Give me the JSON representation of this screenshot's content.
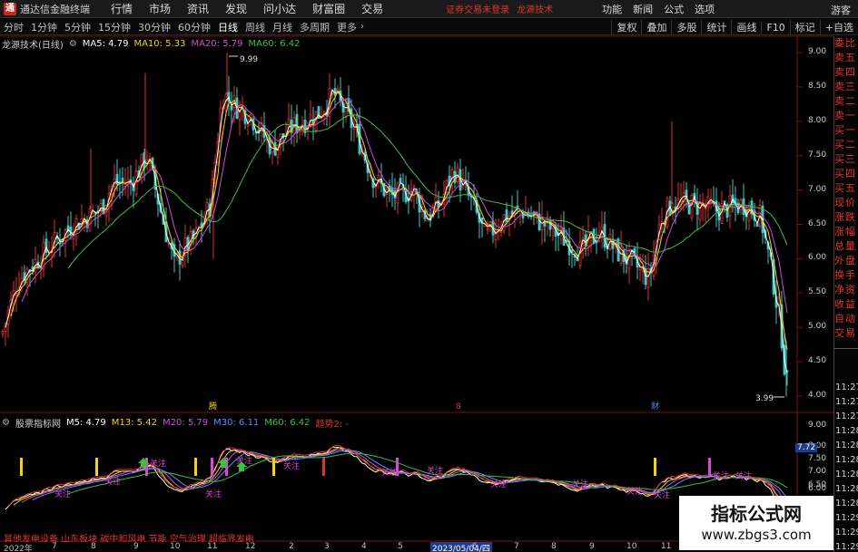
{
  "titlebar": {
    "app_title": "通达信金融终端",
    "menu": [
      "行情",
      "市场",
      "资讯",
      "发现",
      "问小达",
      "财富圈",
      "交易"
    ],
    "login_status": "证券交易未登录",
    "brand_label": "龙源技术",
    "right_items": [
      "功能",
      "新闻",
      "公式",
      "选项"
    ],
    "user_label": "游客"
  },
  "toolbar": {
    "periods": [
      "分时",
      "1分钟",
      "5分钟",
      "15分钟",
      "30分钟",
      "60分钟",
      "日线",
      "周线",
      "月线",
      "多周期",
      "更多"
    ],
    "active_period": "日线",
    "right_buttons": [
      "复权",
      "叠加",
      "多股",
      "统计",
      "画线",
      "F10",
      "标记",
      "+自选"
    ]
  },
  "main_chart": {
    "name": "龙源技术(日线)",
    "ma": [
      {
        "label": "MA5: 4.79",
        "color": "#ffffff"
      },
      {
        "label": "MA10: 5.33",
        "color": "#f2d21b"
      },
      {
        "label": "MA20: 5.79",
        "color": "#d24bd2"
      },
      {
        "label": "MA60: 6.42",
        "color": "#3fbf3f"
      }
    ],
    "high_label": "9.99",
    "low_label": "3.99",
    "markers": [
      "腾",
      "8",
      "财"
    ],
    "y_ticks": [
      "9.00",
      "8.50",
      "8.00",
      "7.50",
      "7.00",
      "6.50",
      "6.00",
      "5.50",
      "5.00",
      "4.50",
      "4.00"
    ]
  },
  "sub_chart": {
    "name": "股票指标网",
    "ma": [
      {
        "label": "M5: 4.79",
        "color": "#ffffff"
      },
      {
        "label": "M13: 5.42",
        "color": "#f2d21b"
      },
      {
        "label": "M20: 5.79",
        "color": "#d24bd2"
      },
      {
        "label": "M30: 6.11",
        "color": "#5a8cff"
      },
      {
        "label": "M60: 6.42",
        "color": "#3fbf3f"
      },
      {
        "label": "趋势2: -",
        "color": "#e0352b"
      }
    ],
    "y_ticks": [
      "9.00",
      "8.00",
      "7.50",
      "7.00",
      "6.50",
      "6.00"
    ],
    "current_value": "7.72",
    "annotations": [
      "关注",
      "关注",
      "关注",
      "关注",
      "关注",
      "关注",
      "关注",
      "关注",
      "关注",
      "关注",
      "关注",
      "关注",
      "关注",
      "关注"
    ]
  },
  "quote_col": {
    "labels": [
      "委比",
      "卖五",
      "卖四",
      "卖三",
      "卖二",
      "卖一",
      "买一",
      "买二",
      "买三",
      "买四",
      "买五",
      "现价",
      "涨跌",
      "涨幅",
      "总量",
      "外盘",
      "换手",
      "净资",
      "收益",
      "自动",
      "交易"
    ],
    "times": [
      "11:27",
      "11:27",
      "11:27",
      "11:28",
      "11:28",
      "11:28",
      "11:28",
      "11:28",
      "11:28",
      "11:29",
      "11:29",
      "11:29",
      "11:29"
    ]
  },
  "bottom_bar": {
    "concepts": "其他发电设备 山东板块 碳中和风电 节能 空气治理 超临界发电"
  },
  "date_axis": {
    "labels": [
      "2022年",
      "7",
      "8",
      "9",
      "10",
      "11",
      "12",
      "2",
      "3",
      "4",
      "5",
      "6",
      "7",
      "8",
      "9",
      "10",
      "11",
      "12"
    ],
    "badge": "2023/05/04/四"
  },
  "watermark": {
    "title": "指标公式网",
    "url": "www.zbgs3.com"
  },
  "colors": {
    "up": "#e0352b",
    "down": "#3fc8c8",
    "ma5": "#ffffff",
    "ma10": "#f2d21b",
    "ma20": "#d24bd2",
    "ma60": "#3fbf3f"
  }
}
